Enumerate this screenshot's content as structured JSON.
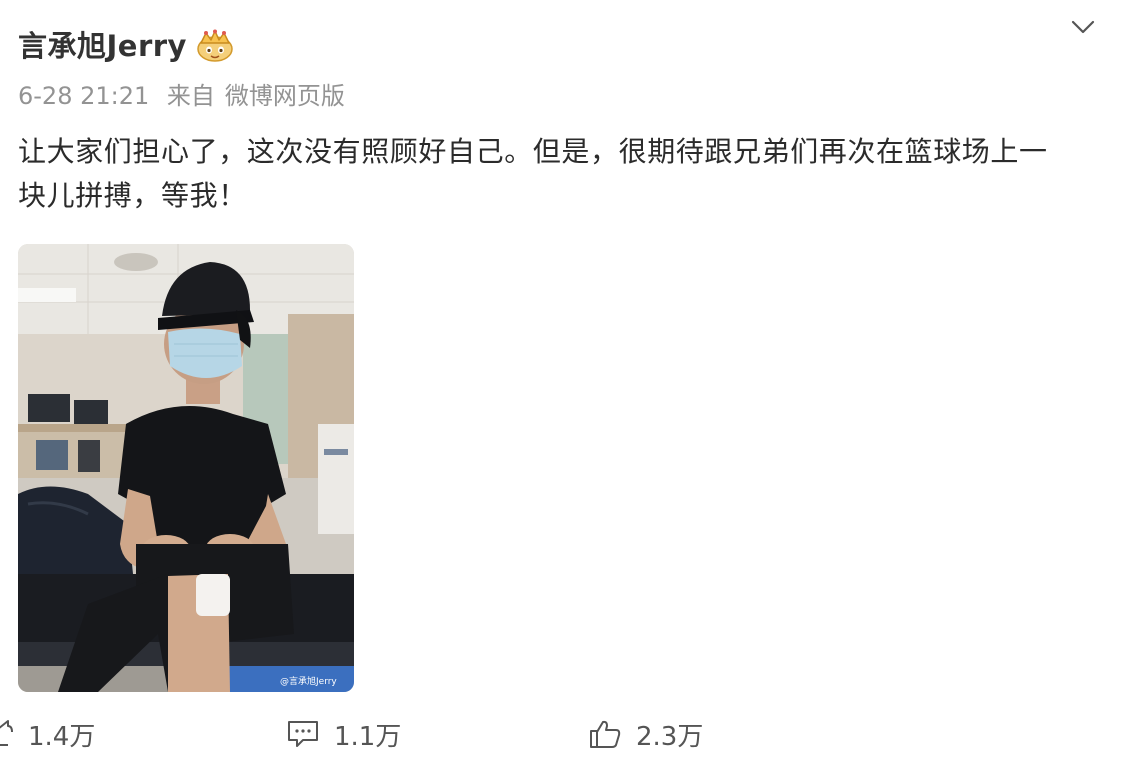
{
  "post": {
    "username": "言承旭Jerry",
    "badge_icon": "gold-crown-badge-icon",
    "menu_icon": "chevron-down-icon",
    "timestamp": "6-28 21:21",
    "source_prefix": "来自",
    "source": "微博网页版",
    "text_line1": "让大家们担心了，这次没有照顾好自己。但是，很期待跟兄弟们再次在篮球场上一",
    "text_line2": "块儿拼搏，等我！",
    "photo_watermark": "@言承旭Jerry",
    "actions": {
      "repost_count": "1.4万",
      "comment_count": "1.1万",
      "like_count": "2.3万"
    }
  },
  "colors": {
    "text": "#333333",
    "meta": "#939393",
    "action": "#555555",
    "badge_gold": "#e8b04a"
  }
}
